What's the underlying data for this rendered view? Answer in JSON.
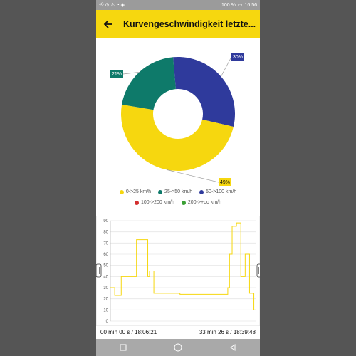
{
  "status": {
    "left_icons": "⁴ᴳ ⊙ ⚠ ◔ ◈",
    "battery": "100 %",
    "time": "16:56"
  },
  "appbar": {
    "title": "Kurvengeschwindigkeit letzte..."
  },
  "pie": {
    "slices": [
      {
        "label": "30%",
        "value": 30,
        "color": "#2f3a9c"
      },
      {
        "label": "49%",
        "value": 49,
        "color": "#f6d70f"
      },
      {
        "label": "21%",
        "value": 21,
        "color": "#0e7a6a"
      }
    ]
  },
  "legend": {
    "items": [
      {
        "label": "0->25 km/h",
        "color": "#f6d70f"
      },
      {
        "label": "25->50 km/h",
        "color": "#0e7a6a"
      },
      {
        "label": "50->100 km/h",
        "color": "#2f3a9c"
      },
      {
        "label": "100->200 km/h",
        "color": "#d32f2f"
      },
      {
        "label": "200->+oo km/h",
        "color": "#3aa035"
      }
    ]
  },
  "chart_data": {
    "type": "line",
    "ylim": [
      0,
      90
    ],
    "yticks": [
      0,
      10,
      20,
      30,
      40,
      50,
      60,
      70,
      80,
      90
    ],
    "series": [
      {
        "color": "#f6d70f",
        "x": [
          0,
          1,
          1,
          2.5,
          2.5,
          3,
          3,
          6,
          6,
          6.6,
          6.6,
          8.6,
          8.6,
          9,
          9,
          10,
          10,
          16,
          16,
          18,
          18,
          19,
          19,
          24,
          24,
          26,
          26,
          27,
          27,
          27.4,
          27.4,
          28,
          28,
          29,
          29,
          30,
          30,
          31,
          31,
          32,
          32,
          33,
          33,
          33.4
        ],
        "values": [
          30,
          30,
          23,
          23,
          40,
          40,
          40,
          40,
          73,
          73,
          73,
          73,
          40,
          40,
          45,
          45,
          25,
          25,
          24,
          24,
          24,
          24,
          24,
          24,
          24,
          24,
          24,
          24,
          30,
          30,
          60,
          60,
          85,
          85,
          88,
          88,
          40,
          40,
          60,
          60,
          25,
          25,
          10,
          10
        ]
      }
    ],
    "x_start_label": "00 min 00 s / 18:06:21",
    "x_end_label": "33 min 26 s / 18:39:48"
  }
}
